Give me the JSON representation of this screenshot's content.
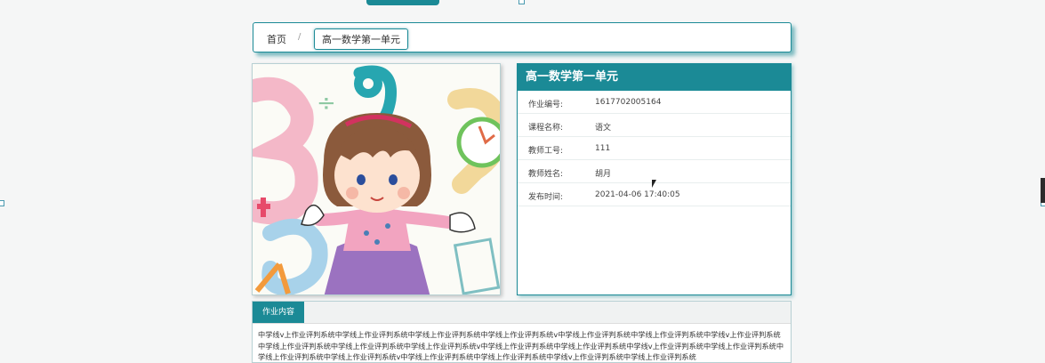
{
  "breadcrumb": {
    "home": "首页",
    "separator": "/",
    "current": "高一数学第一单元"
  },
  "assignment": {
    "title": "高一数学第一单元",
    "rows": [
      {
        "label": "作业编号:",
        "value": "1617702005164"
      },
      {
        "label": "课程名称:",
        "value": "语文"
      },
      {
        "label": "教师工号:",
        "value": "111"
      },
      {
        "label": "教师姓名:",
        "value": "胡月"
      },
      {
        "label": "发布时间:",
        "value": "2021-04-06 17:40:05"
      }
    ]
  },
  "content": {
    "tab_label": "作业内容",
    "text": "中学线v上作业评判系统中学线上作业评判系统中学线上作业评判系统中学线上作业评判系统v中学线上作业评判系统中学线上作业评判系统中学线v上作业评判系统中学线上作业评判系统中学线上作业评判系统中学线上作业评判系统v中学线上作业评判系统中学线上作业评判系统中学线v上作业评判系统中学线上作业评判系统中学线上作业评判系统中学线上作业评判系统v中学线上作业评判系统中学线上作业评判系统中学线v上作业评判系统中学线上作业评判系统"
  },
  "colors": {
    "accent": "#1b8a96"
  },
  "icons": {
    "cursor": "mouse-pointer-icon"
  }
}
